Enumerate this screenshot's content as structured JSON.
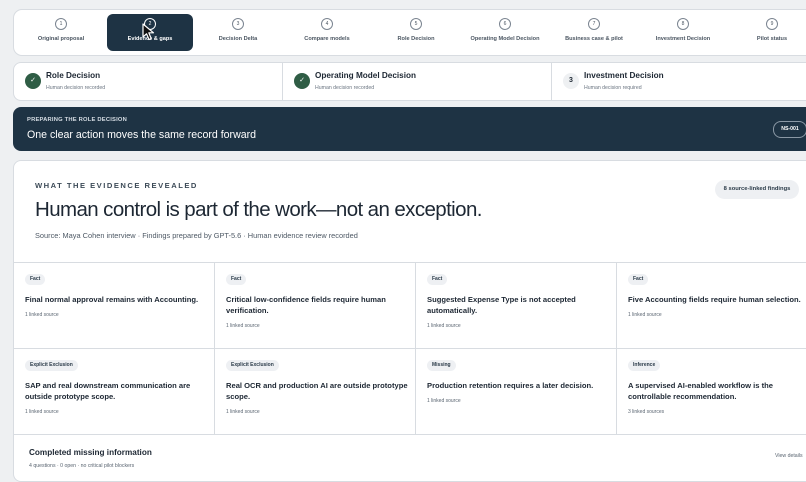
{
  "stepper": {
    "steps": [
      {
        "num": "1",
        "label": "Original proposal"
      },
      {
        "num": "2",
        "label": "Evidence & gaps"
      },
      {
        "num": "3",
        "label": "Decision Delta"
      },
      {
        "num": "4",
        "label": "Compare models"
      },
      {
        "num": "5",
        "label": "Role Decision"
      },
      {
        "num": "6",
        "label": "Operating Model Decision"
      },
      {
        "num": "7",
        "label": "Business case & pilot"
      },
      {
        "num": "8",
        "label": "Investment Decision"
      },
      {
        "num": "9",
        "label": "Pilot status"
      }
    ],
    "active_step": "2"
  },
  "decisions": [
    {
      "badge": "✓",
      "title": "Role Decision",
      "sub": "Human decision recorded",
      "state": "done"
    },
    {
      "badge": "✓",
      "title": "Operating Model Decision",
      "sub": "Human decision recorded",
      "state": "done"
    },
    {
      "badge": "3",
      "title": "Investment Decision",
      "sub": "Human decision required",
      "state": "pending"
    }
  ],
  "banner": {
    "eyebrow": "PREPARING THE ROLE DECISION",
    "headline": "One clear action moves the same record forward",
    "record_id": "NS-001"
  },
  "evidence": {
    "eyebrow": "WHAT THE EVIDENCE REVEALED",
    "headline": "Human control is part of the work—not an exception.",
    "source": "Source: Maya Cohen interview · Findings prepared by GPT-5.6 · Human evidence review recorded",
    "findings_pill": "8 source-linked findings",
    "findings": [
      {
        "tag": "Fact",
        "title": "Final normal approval remains with Accounting.",
        "links": "1 linked source"
      },
      {
        "tag": "Fact",
        "title": "Critical low-confidence fields require human verification.",
        "links": "1 linked source"
      },
      {
        "tag": "Fact",
        "title": "Suggested Expense Type is not accepted automatically.",
        "links": "1 linked source"
      },
      {
        "tag": "Fact",
        "title": "Five Accounting fields require human selection.",
        "links": "1 linked source"
      },
      {
        "tag": "Explicit Exclusion",
        "title": "SAP and real downstream communication are outside prototype scope.",
        "links": "1 linked source"
      },
      {
        "tag": "Explicit Exclusion",
        "title": "Real OCR and production AI are outside prototype scope.",
        "links": "1 linked source"
      },
      {
        "tag": "Missing",
        "title": "Production retention requires a later decision.",
        "links": "1 linked source"
      },
      {
        "tag": "Inference",
        "title": "A supervised AI-enabled workflow is the controllable recommendation.",
        "links": "3 linked sources"
      }
    ]
  },
  "missing": {
    "title": "Completed missing information",
    "sub": "4 questions · 0 open · no critical pilot blockers",
    "view_label": "View details"
  }
}
